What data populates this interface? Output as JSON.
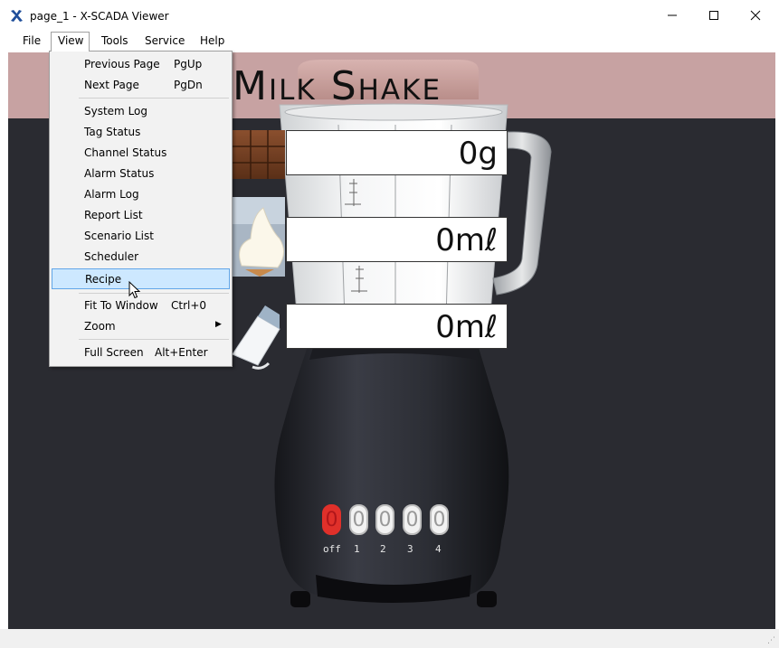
{
  "window": {
    "title": "page_1 - X-SCADA Viewer"
  },
  "menubar": {
    "items": [
      {
        "label": "File"
      },
      {
        "label": "View"
      },
      {
        "label": "Tools"
      },
      {
        "label": "Service"
      },
      {
        "label": "Help"
      }
    ]
  },
  "view_menu": {
    "items": [
      {
        "label": "Previous Page",
        "shortcut": "PgUp"
      },
      {
        "label": "Next Page",
        "shortcut": "PgDn"
      },
      {
        "label": "System Log",
        "shortcut": ""
      },
      {
        "label": "Tag Status",
        "shortcut": ""
      },
      {
        "label": "Channel Status",
        "shortcut": ""
      },
      {
        "label": "Alarm Status",
        "shortcut": ""
      },
      {
        "label": "Alarm Log",
        "shortcut": ""
      },
      {
        "label": "Report List",
        "shortcut": ""
      },
      {
        "label": "Scenario List",
        "shortcut": ""
      },
      {
        "label": "Scheduler",
        "shortcut": ""
      },
      {
        "label": "Recipe",
        "shortcut": "",
        "highlighted": true
      },
      {
        "label": "Fit To Window",
        "shortcut": "Ctrl+0"
      },
      {
        "label": "Zoom",
        "shortcut": "",
        "submenu": true
      },
      {
        "label": "Full Screen",
        "shortcut": "Alt+Enter"
      }
    ]
  },
  "page": {
    "title": "Milk Shake",
    "readouts": {
      "chocolate": "0g",
      "ice_cream": "0mℓ",
      "milk": "0mℓ"
    },
    "speed_buttons": [
      {
        "glyph": "0",
        "label": "off",
        "active": true
      },
      {
        "glyph": "0",
        "label": "1",
        "active": false
      },
      {
        "glyph": "0",
        "label": "2",
        "active": false
      },
      {
        "glyph": "0",
        "label": "3",
        "active": false
      },
      {
        "glyph": "0",
        "label": "4",
        "active": false
      }
    ]
  },
  "colors": {
    "canvas_bg": "#2a2b31",
    "header_band": "#c7a2a2",
    "active_speed": "#e0302a",
    "menu_highlight": "#cde8ff",
    "app_icon": "#1f4e9a"
  },
  "icons": {
    "app": "x-scada-logo-icon",
    "minimize": "minimize-icon",
    "maximize": "maximize-icon",
    "close": "close-icon",
    "cursor": "mouse-pointer-icon"
  }
}
